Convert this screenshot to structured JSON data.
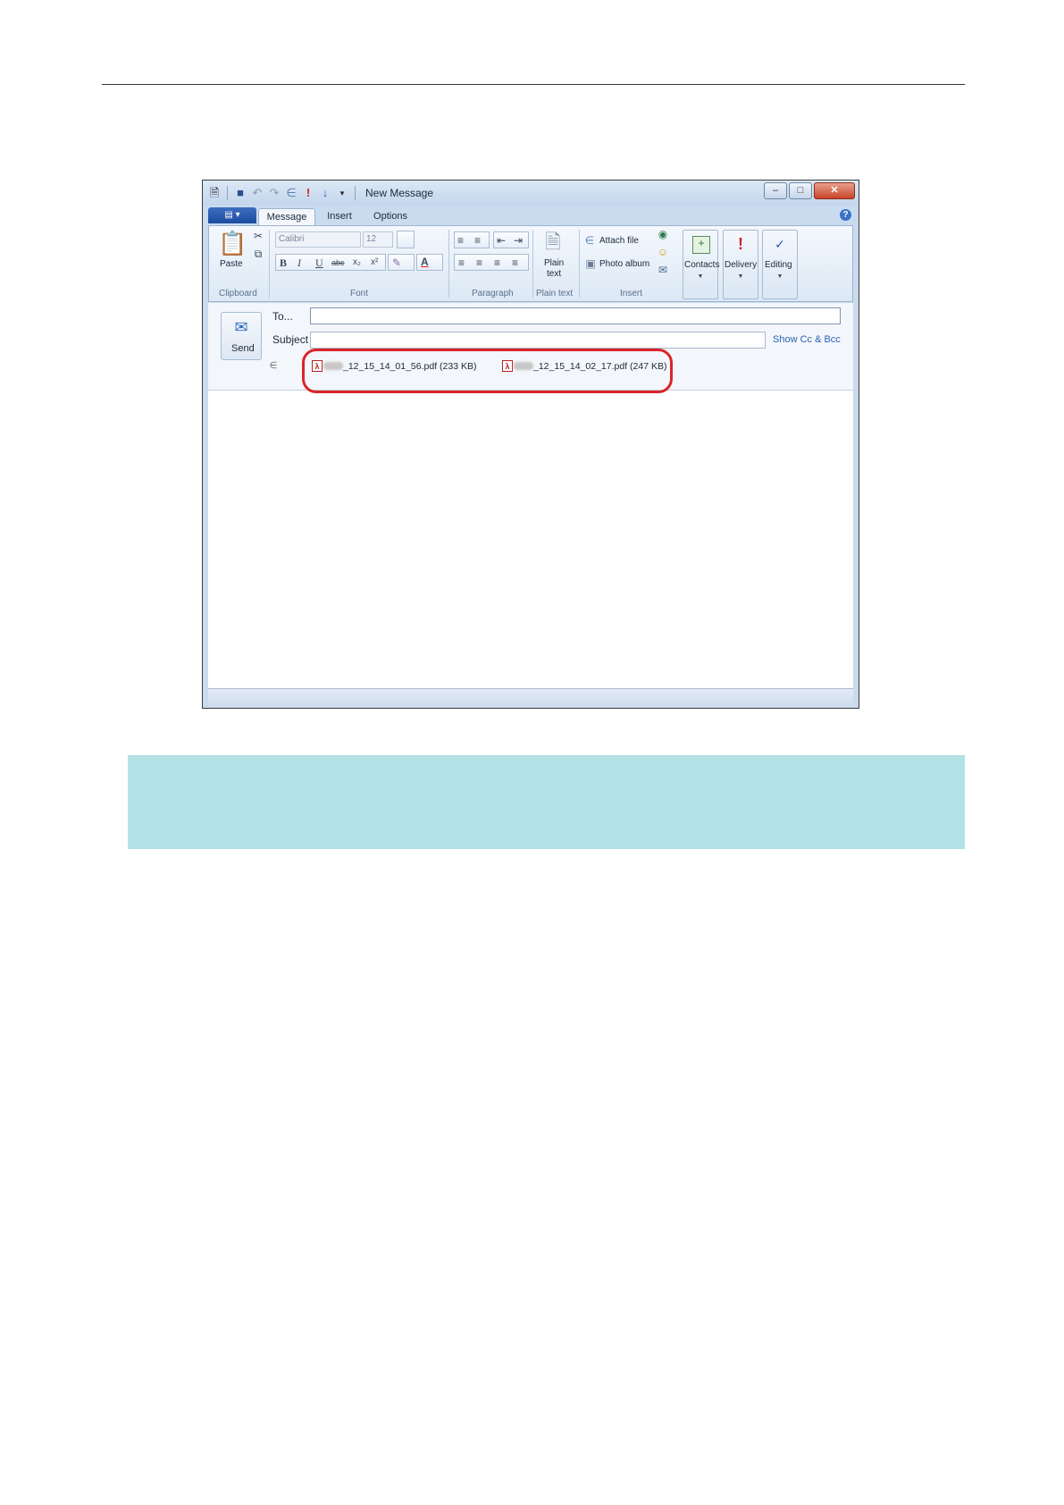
{
  "window": {
    "title": "New Message"
  },
  "app_menu": {
    "label": "▤ ▾"
  },
  "tabs": [
    {
      "label": "Message"
    },
    {
      "label": "Insert"
    },
    {
      "label": "Options"
    }
  ],
  "ribbon": {
    "clipboard": {
      "paste": "Paste",
      "group": "Clipboard"
    },
    "font": {
      "family": "Calibri",
      "size": "12",
      "group": "Font"
    },
    "paragraph": {
      "group": "Paragraph"
    },
    "plain_text": {
      "line1": "Plain",
      "line2": "text",
      "group": "Plain text"
    },
    "insert": {
      "attach_file": "Attach file",
      "photo_album": "Photo album",
      "group": "Insert"
    },
    "contacts": "Contacts",
    "delivery": "Delivery",
    "editing": "Editing"
  },
  "compose": {
    "send": "Send",
    "to_label": "To...",
    "to_value": "",
    "subject_label": "Subject",
    "subject_value": "",
    "show_cc_bcc": "Show Cc & Bcc",
    "attachments": [
      {
        "name": "_12_15_14_01_56.pdf (233 KB)"
      },
      {
        "name": "_12_15_14_02_17.pdf (247 KB)"
      }
    ]
  },
  "colors": {
    "highlight_oval": "#d9262a",
    "note_box": "#b2e2e5"
  }
}
